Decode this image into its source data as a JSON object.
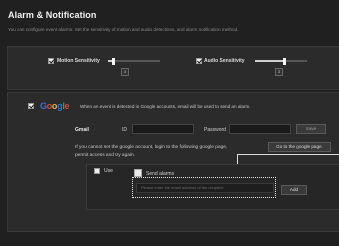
{
  "header": {
    "title": "Alarm & Notification",
    "subtitle": "You can configure event alarms. Set the sensitivity of motion and audio detections, and alarm notification method."
  },
  "sensitivity": {
    "motion": {
      "label": "Motion Sensitivity",
      "value": "3",
      "checked": true,
      "level": 0.1
    },
    "audio": {
      "label": "Audio Sensitivity",
      "value": "3",
      "checked": true,
      "level": 0.55
    }
  },
  "google": {
    "logo_letters": [
      "G",
      "o",
      "o",
      "g",
      "l",
      "e"
    ],
    "logo_colors": [
      "#3b6fd6",
      "#d34a3b",
      "#e2b52c",
      "#3b6fd6",
      "#3aa35a",
      "#d34a3b"
    ],
    "checked": true,
    "note": "When an event is detected in Google accounts, email will be used to send an alarm.",
    "gmail_label": "Gmail",
    "id_label": "ID",
    "id_value": "",
    "password_label": "Password",
    "password_value": "",
    "save_label": "Save",
    "help_line1": "If you cannot set the google account, login to the following google page,",
    "help_line2": "permit access and try again.",
    "go_button_label": "Go to the google page.",
    "use_label": "Use",
    "use_checked": false,
    "send_alarms_label": "Send alarms",
    "recipient_placeholder": "Please enter the email address of the recipient.",
    "add_label": "Add"
  }
}
